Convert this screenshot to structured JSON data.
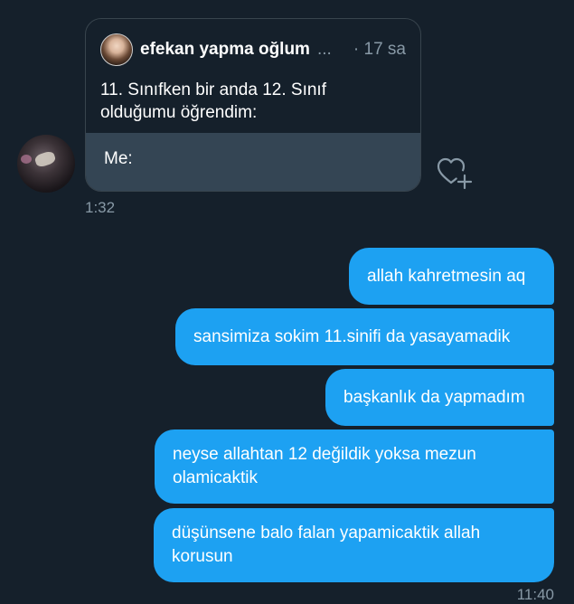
{
  "quoted_tweet": {
    "author_name": "efekan yapma oğlum",
    "ellipsis": "...",
    "time": "· 17 sa",
    "text": "11. Sınıfken bir anda 12. Sınıf olduğumu öğrendim:",
    "media_text": "Me:"
  },
  "received_time": "1:32",
  "sent_messages": [
    "allah kahretmesin aq",
    "sansimiza sokim 11.sinifi da yasayamadik",
    "başkanlık da yapmadım",
    "neyse allahtan 12 değildik yoksa mezun olamicaktik",
    "düşünsene balo falan yapamicaktik allah korusun"
  ],
  "sent_time": "11:40",
  "colors": {
    "background": "#15202b",
    "bubble": "#1da1f2",
    "muted_text": "#8899a6",
    "media_panel": "#344554"
  },
  "icons": {
    "react": "heart-add-icon"
  }
}
